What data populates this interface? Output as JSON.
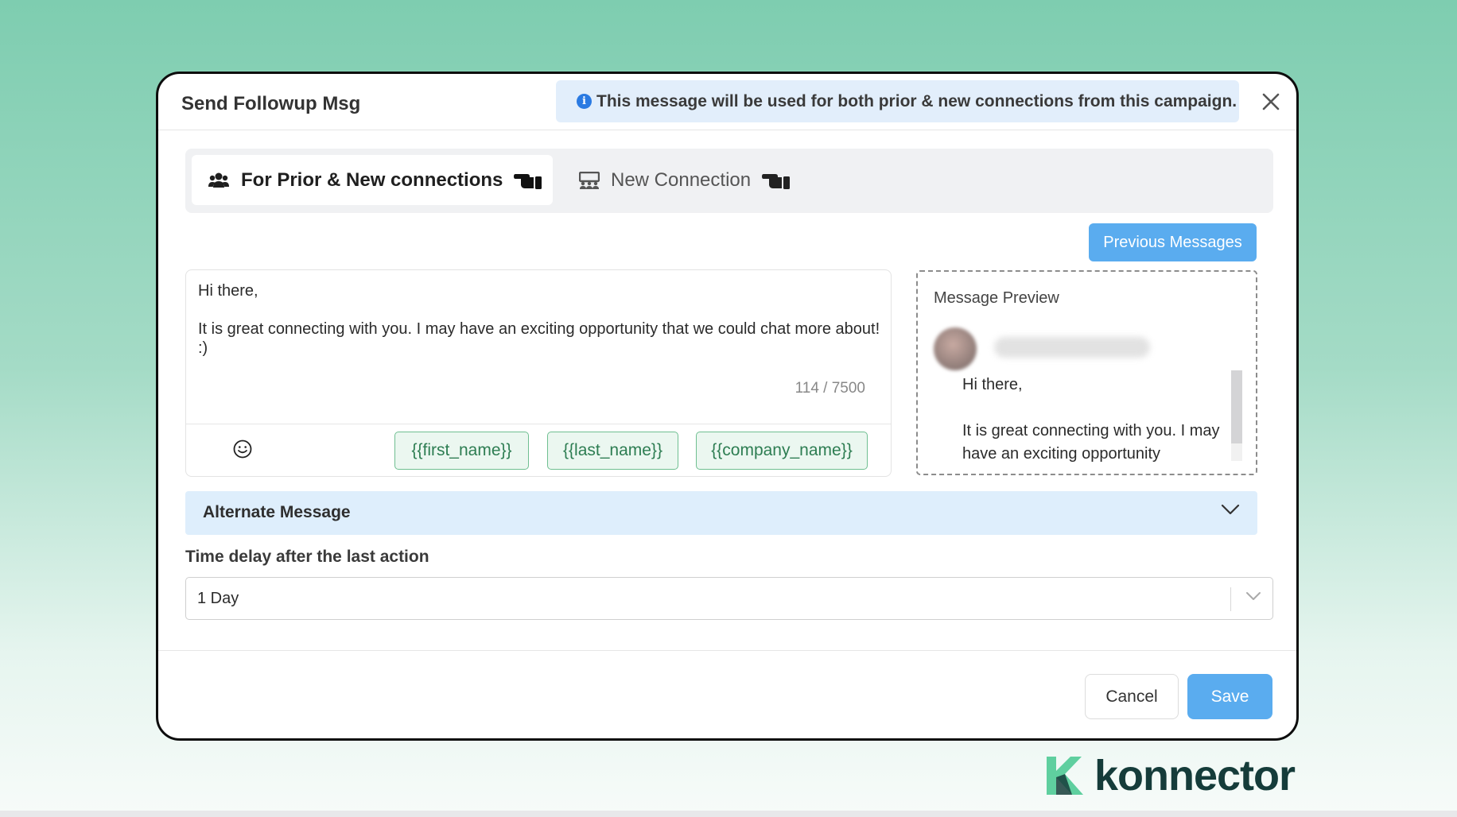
{
  "modal": {
    "title": "Send Followup Msg",
    "info_text": "This message will be used for both prior & new connections from this campaign.",
    "info_icon": "i"
  },
  "tabs": [
    {
      "label": "For Prior & New connections",
      "icon": "users-icon",
      "active": true
    },
    {
      "label": "New Connection",
      "icon": "grid-users-icon",
      "active": false
    }
  ],
  "previous_messages_label": "Previous Messages",
  "editor": {
    "message": "Hi there,\n\nIt is great connecting with you. I may have an exciting opportunity that we could chat more about! :)",
    "char_count": "114 / 7500",
    "variables": [
      "{{first_name}}",
      "{{last_name}}",
      "{{company_name}}"
    ]
  },
  "preview": {
    "title": "Message Preview",
    "body": "Hi there,\n\nIt is great connecting with you. I may have an exciting opportunity"
  },
  "alternate_message": {
    "label": "Alternate Message"
  },
  "time_delay": {
    "label": "Time delay after the last action",
    "value": "1 Day"
  },
  "footer": {
    "cancel_label": "Cancel",
    "save_label": "Save"
  },
  "brand": {
    "name": "konnector"
  },
  "colors": {
    "accent": "#5aacef",
    "chip_border": "#6fbf91",
    "brand_dark": "#153c3a",
    "brand_green": "#5fcf9f"
  }
}
